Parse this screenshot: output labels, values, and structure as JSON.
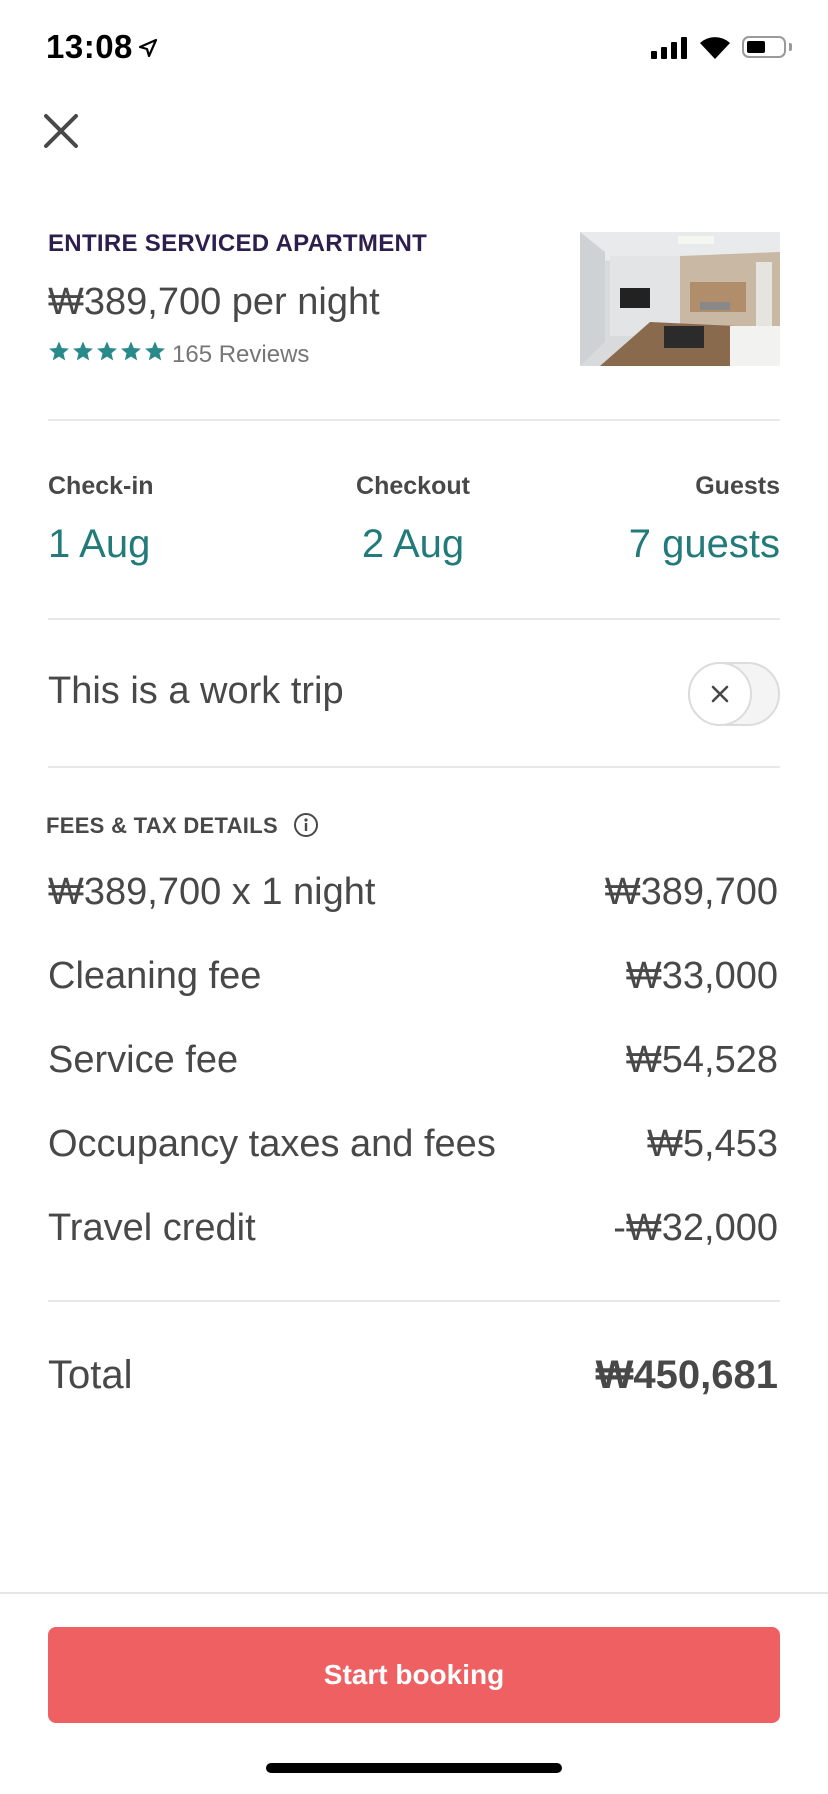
{
  "status_bar": {
    "time": "13:08"
  },
  "listing": {
    "type": "ENTIRE SERVICED APARTMENT",
    "price_per_night": "₩389,700 per night",
    "rating_stars": 5,
    "reviews": "165 Reviews"
  },
  "trip": {
    "checkin_label": "Check-in",
    "checkin_value": "1 Aug",
    "checkout_label": "Checkout",
    "checkout_value": "2 Aug",
    "guests_label": "Guests",
    "guests_value": "7 guests"
  },
  "work_trip": {
    "label": "This is a work trip",
    "enabled": false
  },
  "fees": {
    "title": "FEES & TAX DETAILS",
    "items": [
      {
        "label": "₩389,700 x 1 night",
        "value": "₩389,700"
      },
      {
        "label": "Cleaning fee",
        "value": "₩33,000"
      },
      {
        "label": "Service fee",
        "value": "₩54,528"
      },
      {
        "label": "Occupancy taxes and fees",
        "value": "₩5,453"
      },
      {
        "label": "Travel credit",
        "value": "-₩32,000"
      }
    ]
  },
  "total": {
    "label": "Total",
    "value": "₩450,681"
  },
  "cta": {
    "label": "Start booking"
  },
  "colors": {
    "accent_teal": "#227a7a",
    "star_teal": "#2a8a8a",
    "button": "#ee6062",
    "heading_purple": "#2d1f4d"
  }
}
